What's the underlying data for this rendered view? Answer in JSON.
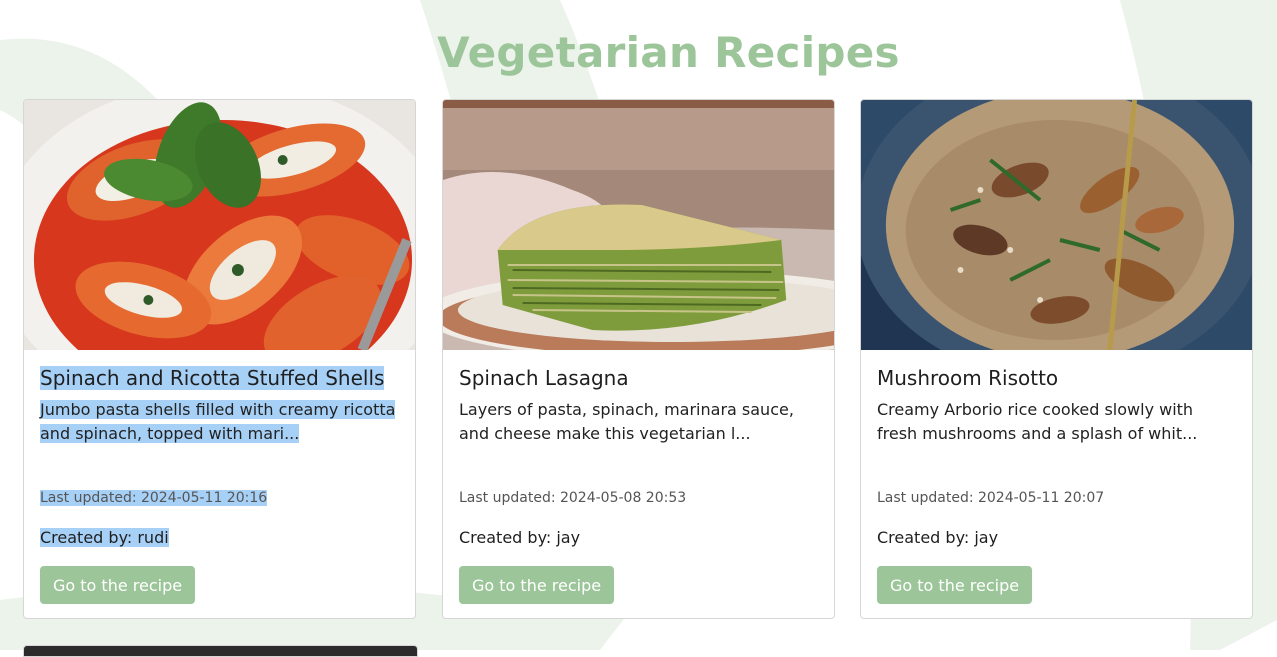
{
  "page": {
    "title": "Vegetarian Recipes"
  },
  "theme": {
    "accent": "#9cc69a",
    "selection": "#a7d0f7",
    "deco": "#ebf3ea"
  },
  "recipes": [
    {
      "title": "Spinach and Ricotta Stuffed Shells",
      "description": "Jumbo pasta shells filled with creamy ricotta and spinach, topped with mari...",
      "updated": "Last updated: 2024-05-11 20:16",
      "creator": "Created by: rudi",
      "button": "Go to the recipe",
      "image": "stuffed-shells-photo"
    },
    {
      "title": "Spinach Lasagna",
      "description": "Layers of pasta, spinach, marinara sauce, and cheese make this vegetarian l...",
      "updated": "Last updated: 2024-05-08 20:53",
      "creator": "Created by: jay",
      "button": "Go to the recipe",
      "image": "spinach-lasagna-photo"
    },
    {
      "title": "Mushroom Risotto",
      "description": "Creamy Arborio rice cooked slowly with fresh mushrooms and a splash of whit...",
      "updated": "Last updated: 2024-05-11 20:07",
      "creator": "Created by: jay",
      "button": "Go to the recipe",
      "image": "mushroom-risotto-photo"
    }
  ]
}
